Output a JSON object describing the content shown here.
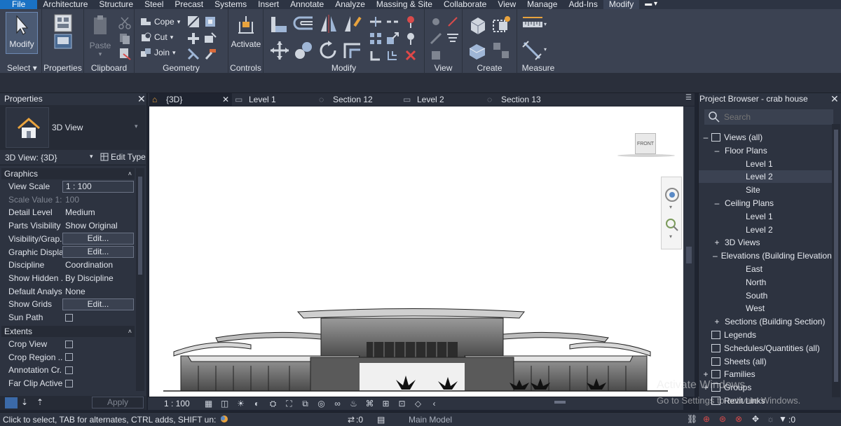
{
  "menubar": {
    "items": [
      "File",
      "Architecture",
      "Structure",
      "Steel",
      "Precast",
      "Systems",
      "Insert",
      "Annotate",
      "Analyze",
      "Massing & Site",
      "Collaborate",
      "View",
      "Manage",
      "Add-Ins",
      "Modify"
    ],
    "active": "Modify"
  },
  "ribbon": {
    "modify_label": "Modify",
    "select_label": "Select",
    "properties_label": "Properties",
    "paste_label": "Paste",
    "clipboard_label": "Clipboard",
    "cope_label": "Cope",
    "cut_label": "Cut",
    "join_label": "Join",
    "geometry_label": "Geometry",
    "activate_label": "Activate",
    "controls_label": "Controls",
    "modify_group_label": "Modify",
    "view_label": "View",
    "create_label": "Create",
    "measure_label": "Measure"
  },
  "properties": {
    "title": "Properties",
    "type_name": "3D View",
    "instance_selector": "3D View: {3D}",
    "edit_type": "Edit Type",
    "apply": "Apply",
    "graphics_header": "Graphics",
    "extents_header": "Extents",
    "graphics_rows": [
      {
        "k": "View Scale",
        "v": "1 : 100",
        "kind": "box"
      },
      {
        "k": "Scale Value   1:",
        "v": "100",
        "kind": "dim"
      },
      {
        "k": "Detail Level",
        "v": "Medium",
        "kind": "text"
      },
      {
        "k": "Parts Visibility",
        "v": "Show Original",
        "kind": "text"
      },
      {
        "k": "Visibility/Grap...",
        "v": "Edit...",
        "kind": "btn"
      },
      {
        "k": "Graphic Displa...",
        "v": "Edit...",
        "kind": "btn"
      },
      {
        "k": "Discipline",
        "v": "Coordination",
        "kind": "text"
      },
      {
        "k": "Show Hidden ...",
        "v": "By Discipline",
        "kind": "text"
      },
      {
        "k": "Default Analys...",
        "v": "None",
        "kind": "text"
      },
      {
        "k": "Show Grids",
        "v": "Edit...",
        "kind": "btn"
      },
      {
        "k": "Sun Path",
        "v": "",
        "kind": "check"
      }
    ],
    "extents_rows": [
      {
        "k": "Crop View",
        "v": "",
        "kind": "check"
      },
      {
        "k": "Crop Region ...",
        "v": "",
        "kind": "check"
      },
      {
        "k": "Annotation Cr...",
        "v": "",
        "kind": "check"
      },
      {
        "k": "Far Clip Active",
        "v": "",
        "kind": "check"
      }
    ]
  },
  "tabs": [
    {
      "label": "{3D}",
      "active": true,
      "icon": "home-icon"
    },
    {
      "label": "Level 1",
      "active": false,
      "icon": "plan-icon"
    },
    {
      "label": "Section 12",
      "active": false,
      "icon": "section-icon"
    },
    {
      "label": "Level 2",
      "active": false,
      "icon": "plan-icon"
    },
    {
      "label": "Section 13",
      "active": false,
      "icon": "section-icon"
    }
  ],
  "viewcube": {
    "label": "FRONT"
  },
  "viewbar": {
    "scale": "1 : 100"
  },
  "browser": {
    "title": "Project Browser - crab house",
    "search_placeholder": "Search",
    "items": [
      {
        "label": "Views (all)",
        "level": 0,
        "toggle": "–",
        "icon": true
      },
      {
        "label": "Floor Plans",
        "level": 1,
        "toggle": "–",
        "icon": false
      },
      {
        "label": "Level 1",
        "level": 2,
        "toggle": "",
        "icon": false
      },
      {
        "label": "Level 2",
        "level": 2,
        "toggle": "",
        "icon": false,
        "selected": true
      },
      {
        "label": "Site",
        "level": 2,
        "toggle": "",
        "icon": false
      },
      {
        "label": "Ceiling Plans",
        "level": 1,
        "toggle": "–",
        "icon": false
      },
      {
        "label": "Level 1",
        "level": 2,
        "toggle": "",
        "icon": false
      },
      {
        "label": "Level 2",
        "level": 2,
        "toggle": "",
        "icon": false
      },
      {
        "label": "3D Views",
        "level": 1,
        "toggle": "+",
        "icon": false
      },
      {
        "label": "Elevations (Building Elevation)",
        "level": 1,
        "toggle": "–",
        "icon": false
      },
      {
        "label": "East",
        "level": 2,
        "toggle": "",
        "icon": false
      },
      {
        "label": "North",
        "level": 2,
        "toggle": "",
        "icon": false
      },
      {
        "label": "South",
        "level": 2,
        "toggle": "",
        "icon": false
      },
      {
        "label": "West",
        "level": 2,
        "toggle": "",
        "icon": false
      },
      {
        "label": "Sections (Building Section)",
        "level": 1,
        "toggle": "+",
        "icon": false
      },
      {
        "label": "Legends",
        "level": 0,
        "toggle": "",
        "icon": true
      },
      {
        "label": "Schedules/Quantities (all)",
        "level": 0,
        "toggle": "",
        "icon": true
      },
      {
        "label": "Sheets (all)",
        "level": 0,
        "toggle": "",
        "icon": true
      },
      {
        "label": "Families",
        "level": 0,
        "toggle": "+",
        "icon": true
      },
      {
        "label": "Groups",
        "level": 0,
        "toggle": "+",
        "icon": true
      },
      {
        "label": "Revit Links",
        "level": 0,
        "toggle": "",
        "icon": true
      }
    ]
  },
  "status": {
    "hint": "Click to select, TAB for alternates, CTRL adds, SHIFT un:",
    "workset_count": ":0",
    "model": "Main Model",
    "filter_count": ":0"
  },
  "watermark": {
    "line1": "Activate Windows",
    "line2": "Go to Settings to activate Windows."
  }
}
